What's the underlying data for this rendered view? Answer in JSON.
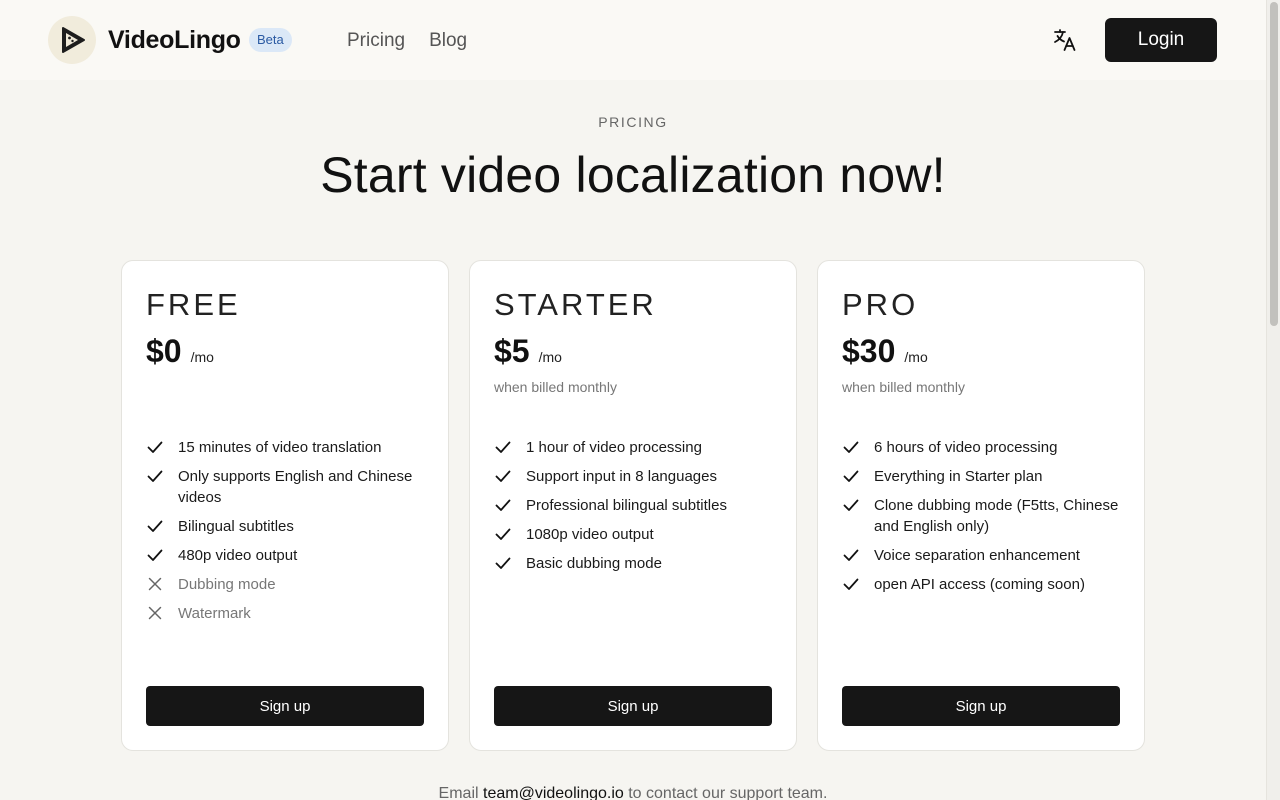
{
  "header": {
    "brand": "VideoLingo",
    "badge": "Beta",
    "nav": [
      "Pricing",
      "Blog"
    ],
    "login_label": "Login"
  },
  "hero": {
    "eyebrow": "PRICING",
    "headline": "Start video localization now!"
  },
  "plans": [
    {
      "name": "FREE",
      "price": "$0",
      "period": "/mo",
      "billing": "",
      "features": [
        {
          "text": "15 minutes of video translation",
          "included": true
        },
        {
          "text": "Only supports English and Chinese videos",
          "included": true
        },
        {
          "text": "Bilingual subtitles",
          "included": true
        },
        {
          "text": "480p video output",
          "included": true
        },
        {
          "text": "Dubbing mode",
          "included": false
        },
        {
          "text": "Watermark",
          "included": false
        }
      ],
      "cta": "Sign up"
    },
    {
      "name": "STARTER",
      "price": "$5",
      "period": "/mo",
      "billing": "when billed monthly",
      "features": [
        {
          "text": "1 hour of video processing",
          "included": true
        },
        {
          "text": "Support input in 8 languages",
          "included": true
        },
        {
          "text": "Professional bilingual subtitles",
          "included": true
        },
        {
          "text": "1080p video output",
          "included": true
        },
        {
          "text": "Basic dubbing mode",
          "included": true
        }
      ],
      "cta": "Sign up"
    },
    {
      "name": "PRO",
      "price": "$30",
      "period": "/mo",
      "billing": "when billed monthly",
      "features": [
        {
          "text": "6 hours of video processing",
          "included": true
        },
        {
          "text": "Everything in Starter plan",
          "included": true
        },
        {
          "text": "Clone dubbing mode (F5tts, Chinese and English only)",
          "included": true
        },
        {
          "text": "Voice separation enhancement",
          "included": true
        },
        {
          "text": "open API access (coming soon)",
          "included": true
        }
      ],
      "cta": "Sign up"
    }
  ],
  "footer": {
    "prefix": "Email",
    "email": "team@videolingo.io",
    "suffix": "to contact our support team."
  },
  "icons": {
    "logo": "play-logo-icon",
    "translate": "translate-icon",
    "included": "check-icon",
    "excluded": "x-icon"
  }
}
